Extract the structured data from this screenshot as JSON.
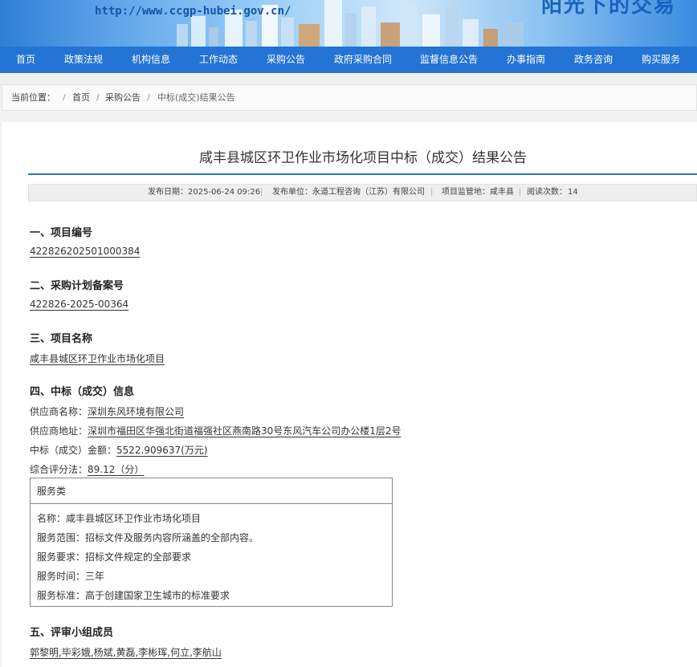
{
  "header": {
    "url": "http://www.ccgp-hubei.gov.cn/",
    "slogan": "阳光下的交易"
  },
  "nav": [
    "首页",
    "政策法规",
    "机构信息",
    "工作动态",
    "采购公告",
    "政府采购合同",
    "监督信息公告",
    "办事指南",
    "政务咨询",
    "购买服务"
  ],
  "breadcrumb": {
    "label": "当前位置：",
    "sep": "/",
    "items": [
      "首页",
      "采购公告",
      "中标(成交)结果公告"
    ]
  },
  "notice": {
    "title": "咸丰县城区环卫作业市场化项目中标（成交）结果公告",
    "meta": {
      "publish_date": "发布日期：2025-06-24 09:26",
      "publisher": "发布单位：永道工程咨询（江苏）有限公司",
      "region": "项目监管地：咸丰县",
      "views_label": "阅读次数：",
      "views": "14"
    },
    "sections": {
      "s1_title": "一、项目编号",
      "s1_value": "422826202501000384",
      "s2_title": "二、采购计划备案号",
      "s2_value": "422826-2025-00364",
      "s3_title": "三、项目名称",
      "s3_value": "咸丰县城区环卫作业市场化项目",
      "s4_title": "四、中标（成交）信息",
      "supplier_label": "供应商名称：",
      "supplier_value": "深圳东风环境有限公司",
      "address_label": "供应商地址：",
      "address_value": "深圳市福田区华强北街道福强社区燕南路30号东风汽车公司办公楼1层2号",
      "amount_label": "中标（成交）金额：",
      "amount_value": "5522.909637(万元)",
      "score_label": "综合评分法：",
      "score_value": "89.12（分）",
      "s5_title": "五、评审小组成员",
      "s5_value": "郭黎明,毕彩娥,杨斌,黄磊,李彬珲,何立,李航山"
    },
    "service": {
      "header": "服务类",
      "name": "名称：咸丰县城区环卫作业市场化项目",
      "scope": "服务范围：招标文件及服务内容所涵盖的全部内容。",
      "requirement": "服务要求：招标文件规定的全部要求",
      "duration": "服务时间：三年",
      "standard": "服务标准：高于创建国家卫生城市的标准要求"
    }
  }
}
